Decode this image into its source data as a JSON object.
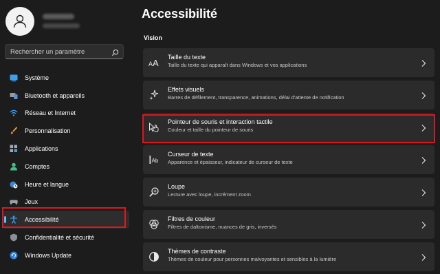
{
  "sidebar": {
    "search_placeholder": "Rechercher un paramètre",
    "items": [
      {
        "label": "Système",
        "icon": "system-icon"
      },
      {
        "label": "Bluetooth et appareils",
        "icon": "bluetooth-icon"
      },
      {
        "label": "Réseau et Internet",
        "icon": "wifi-icon"
      },
      {
        "label": "Personnalisation",
        "icon": "brush-icon"
      },
      {
        "label": "Applications",
        "icon": "apps-icon"
      },
      {
        "label": "Comptes",
        "icon": "account-icon"
      },
      {
        "label": "Heure et langue",
        "icon": "globe-clock-icon"
      },
      {
        "label": "Jeux",
        "icon": "gamepad-icon"
      },
      {
        "label": "Accessibilité",
        "icon": "accessibility-icon",
        "active": true
      },
      {
        "label": "Confidentialité et sécurité",
        "icon": "shield-icon"
      },
      {
        "label": "Windows Update",
        "icon": "update-icon"
      }
    ]
  },
  "main": {
    "title": "Accessibilité",
    "section": "Vision",
    "cards": [
      {
        "title": "Taille du texte",
        "subtitle": "Taille du texte qui apparaît dans Windows et vos applications",
        "icon": "text-size-icon"
      },
      {
        "title": "Effets visuels",
        "subtitle": "Barres de défilement, transparence, animations, délai d'attente de notification",
        "icon": "sparkle-icon"
      },
      {
        "title": "Pointeur de souris et interaction tactile",
        "subtitle": "Couleur et taille du pointeur de souris",
        "icon": "mouse-pointer-icon"
      },
      {
        "title": "Curseur de texte",
        "subtitle": "Apparence et épaisseur, indicateur de curseur de texte",
        "icon": "text-cursor-icon"
      },
      {
        "title": "Loupe",
        "subtitle": "Lecture avec loupe, incrément zoom",
        "icon": "magnifier-icon"
      },
      {
        "title": "Filtres de couleur",
        "subtitle": "Filtres de daltonisme, nuances de gris, inversés",
        "icon": "color-filter-icon"
      },
      {
        "title": "Thèmes de contraste",
        "subtitle": "Thèmes de couleur pour personnes malvoyantes et sensibles à la lumière",
        "icon": "contrast-icon"
      }
    ]
  },
  "colors": {
    "background": "#1c1c1c",
    "card": "#2b2b2b",
    "accent": "#4cc2ff",
    "highlight_box": "#e0151f"
  }
}
